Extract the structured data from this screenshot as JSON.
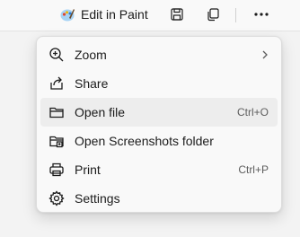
{
  "toolbar": {
    "edit_in_paint_label": "Edit in Paint",
    "buttons": [
      {
        "name": "paint-icon"
      },
      {
        "name": "save-icon"
      },
      {
        "name": "copy-icon"
      },
      {
        "name": "more-options-icon"
      }
    ]
  },
  "menu": {
    "items": [
      {
        "label": "Zoom",
        "icon": "zoom-in-icon",
        "submenu": true
      },
      {
        "label": "Share",
        "icon": "share-icon"
      },
      {
        "label": "Open file",
        "icon": "folder-icon",
        "shortcut": "Ctrl+O",
        "highlighted": true
      },
      {
        "label": "Open Screenshots folder",
        "icon": "screenshots-folder-icon"
      },
      {
        "label": "Print",
        "icon": "printer-icon",
        "shortcut": "Ctrl+P"
      },
      {
        "label": "Settings",
        "icon": "gear-icon"
      }
    ]
  },
  "colors": {
    "background": "#f3f3f3",
    "menu_background": "#f9f9f9",
    "highlight": "#ededed",
    "text": "#1b1b1b",
    "shortcut_text": "#5d5d5d"
  }
}
